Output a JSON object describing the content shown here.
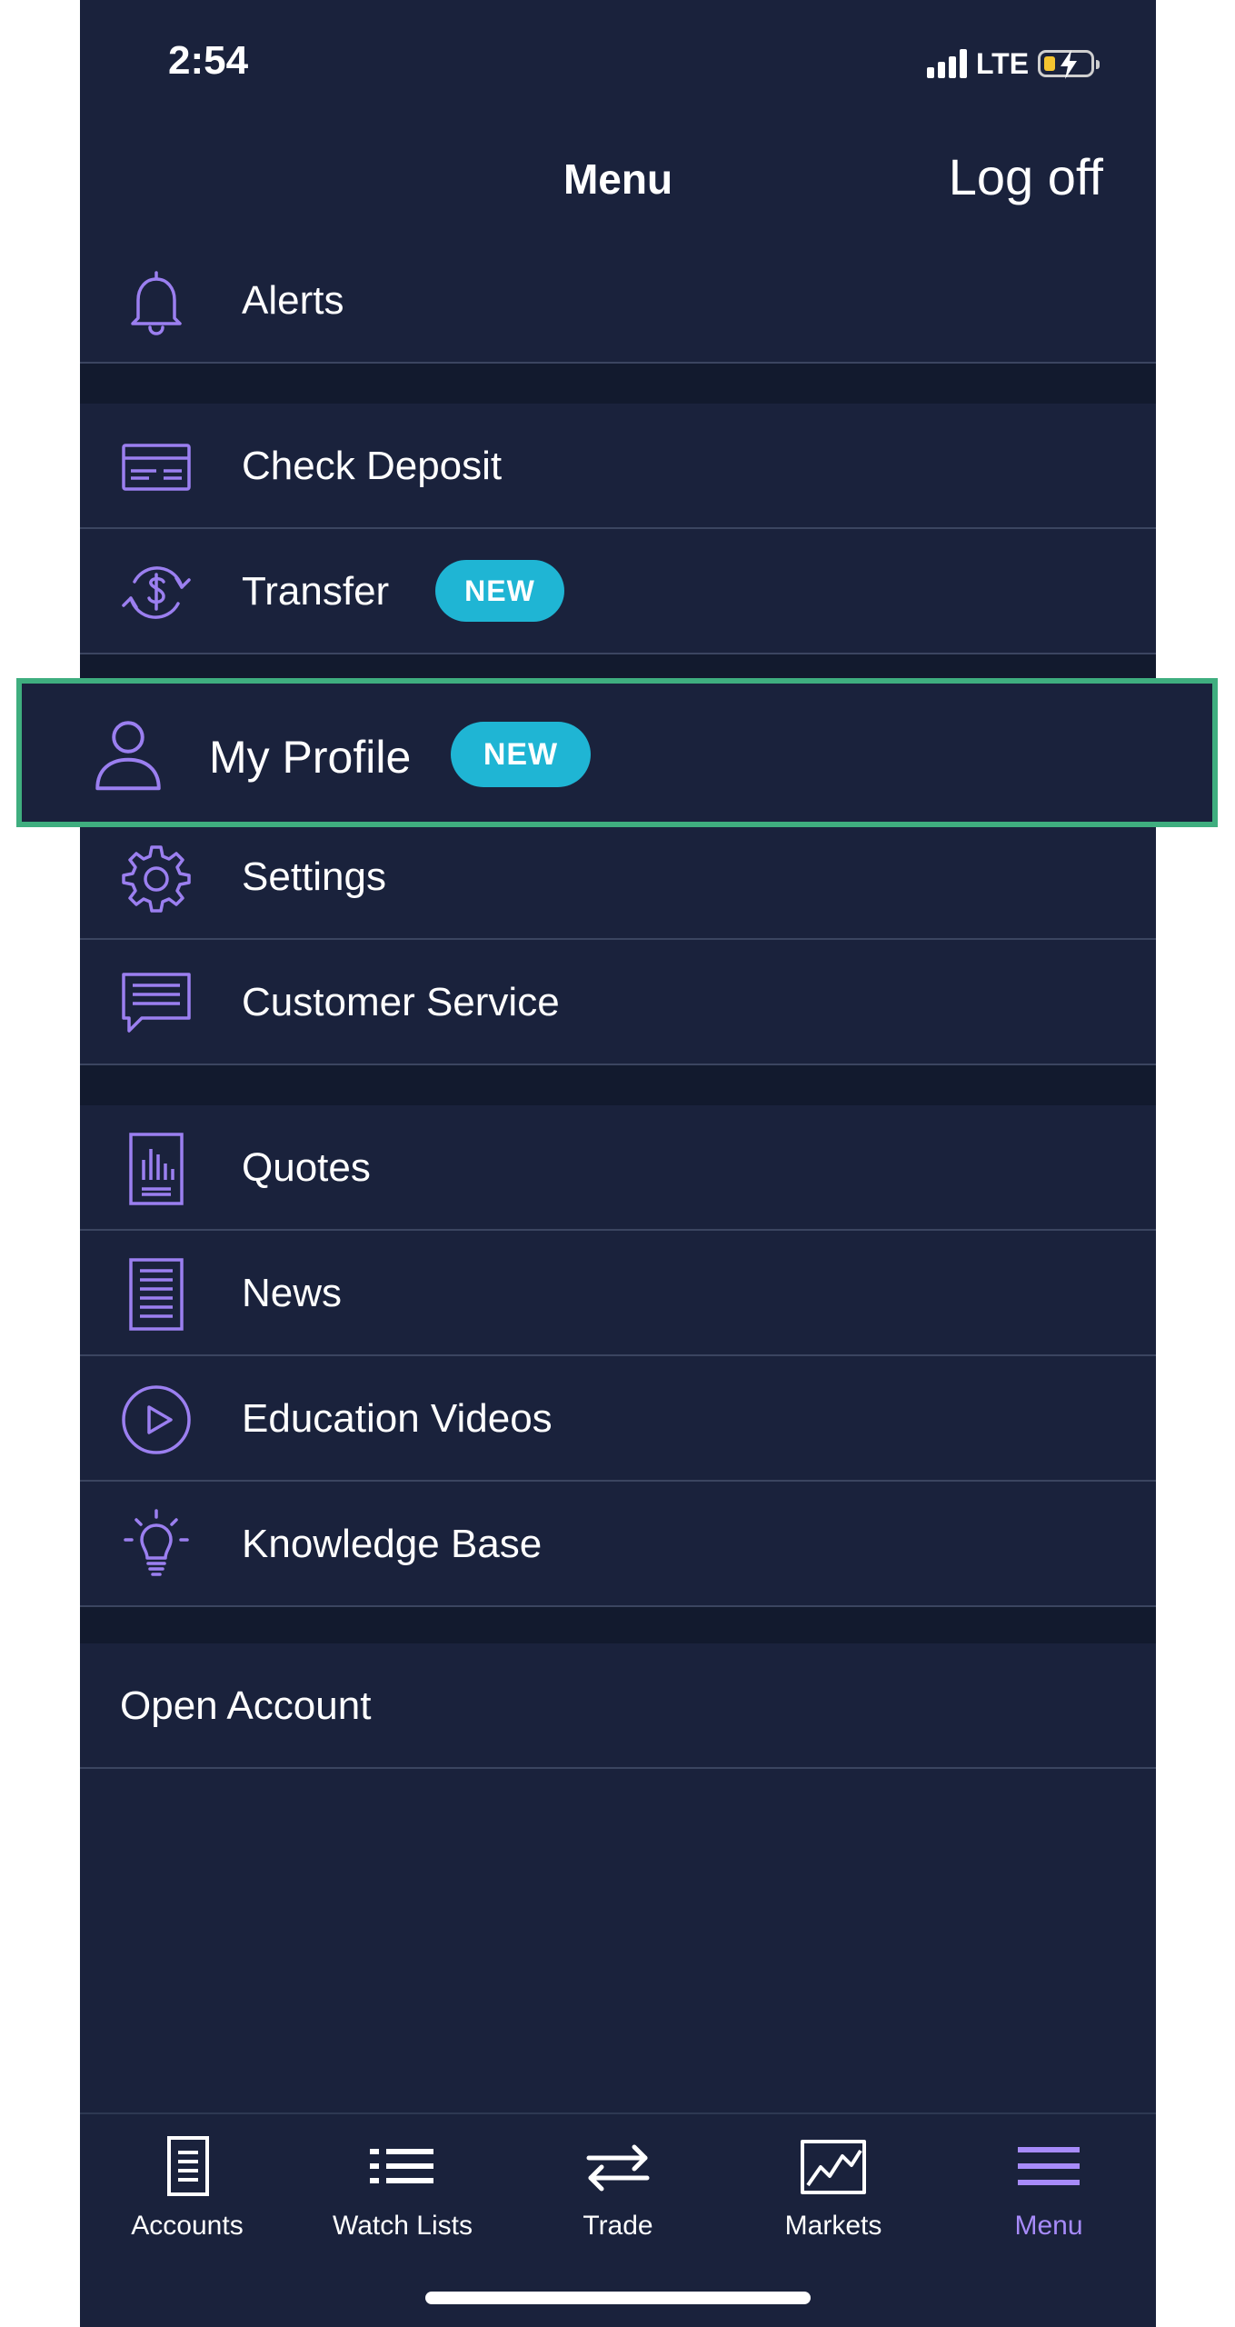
{
  "status_bar": {
    "time": "2:54",
    "network": "LTE"
  },
  "header": {
    "title": "Menu",
    "logoff_label": "Log off"
  },
  "menu": {
    "alerts": "Alerts",
    "check_deposit": "Check Deposit",
    "transfer": "Transfer",
    "transfer_badge": "NEW",
    "my_profile": "My Profile",
    "my_profile_badge": "NEW",
    "settings": "Settings",
    "customer_service": "Customer Service",
    "quotes": "Quotes",
    "news": "News",
    "education_videos": "Education Videos",
    "knowledge_base": "Knowledge Base",
    "open_account": "Open Account"
  },
  "tabbar": {
    "accounts": "Accounts",
    "watch_lists": "Watch Lists",
    "trade": "Trade",
    "markets": "Markets",
    "menu": "Menu",
    "active": "Menu"
  },
  "colors": {
    "background": "#1a223c",
    "section_gap": "#121a2e",
    "icon_accent": "#9b7ff0",
    "badge": "#1fb5d4",
    "highlight_border": "#3fae7f",
    "active_tab": "#a78bfa"
  },
  "icons": {
    "alerts": "bell-icon",
    "check_deposit": "check-card-icon",
    "transfer": "dollar-cycle-icon",
    "my_profile": "person-icon",
    "settings": "gear-icon",
    "customer_service": "chat-bubble-icon",
    "quotes": "quote-doc-icon",
    "news": "news-doc-icon",
    "education_videos": "play-circle-icon",
    "knowledge_base": "lightbulb-icon"
  }
}
